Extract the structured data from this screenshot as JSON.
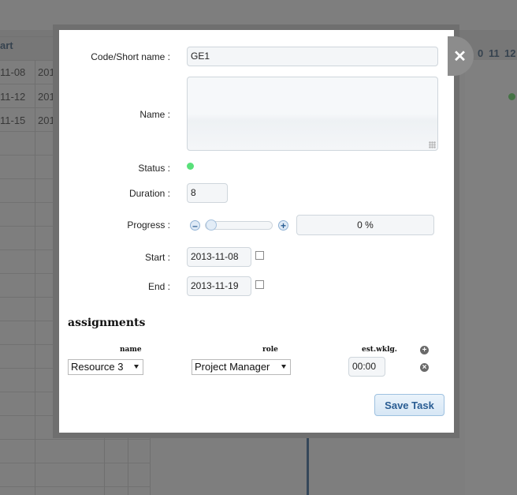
{
  "background": {
    "column_header": "art",
    "rows": [
      {
        "date": "11-08",
        "next": "201"
      },
      {
        "date": "11-12",
        "next": "201"
      },
      {
        "date": "11-15",
        "next": "201"
      }
    ],
    "day_numbers": [
      "0",
      "11",
      "12"
    ]
  },
  "form": {
    "close_glyph": "✕",
    "code": {
      "label": "Code/Short name :",
      "value": "GE1"
    },
    "name": {
      "label": "Name :",
      "value": ""
    },
    "status": {
      "label": "Status :",
      "color": "#59e07a"
    },
    "duration": {
      "label": "Duration :",
      "value": "8"
    },
    "progress": {
      "label": "Progress :",
      "value": "0 %",
      "level": 0,
      "minus": "–",
      "plus": "+"
    },
    "start": {
      "label": "Start :",
      "value": "2013-11-08",
      "milestone": false
    },
    "end": {
      "label": "End :",
      "value": "2013-11-19",
      "milestone": false
    }
  },
  "assignments": {
    "title": "assignments",
    "columns": {
      "name": "name",
      "role": "role",
      "effort": "est.wklg."
    },
    "add_glyph": "+",
    "rows": [
      {
        "resource": "Resource 3",
        "role": "Project Manager",
        "effort": "00:00",
        "remove_glyph": "×"
      }
    ]
  },
  "actions": {
    "save_label": "Save Task"
  },
  "colors": {
    "accent": "#2a5d93",
    "status_green": "#59e07a"
  }
}
